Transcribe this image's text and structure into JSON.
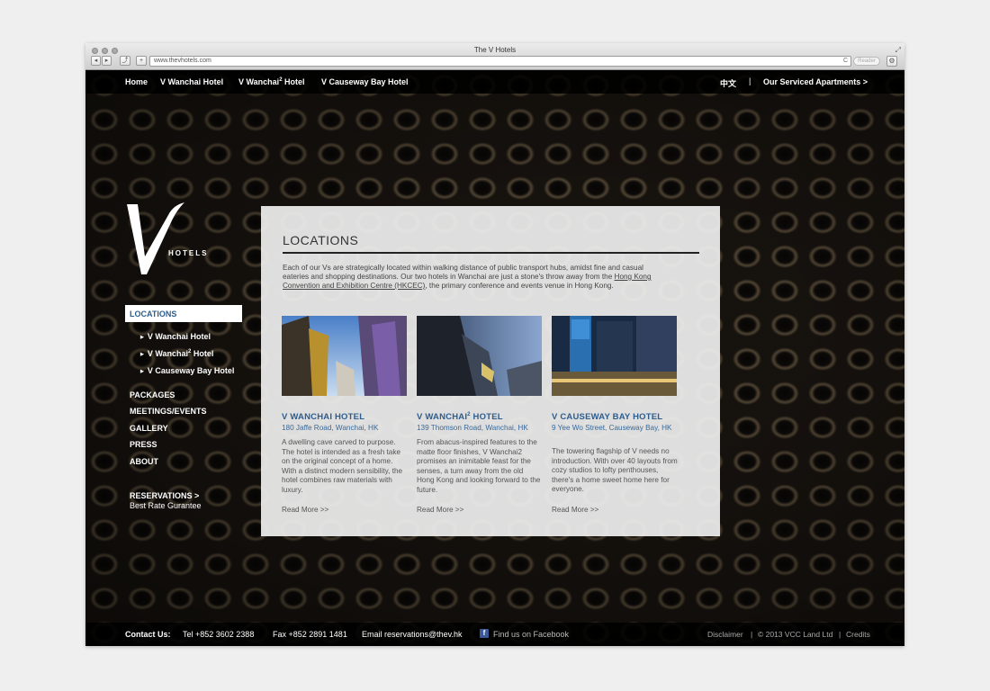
{
  "browser": {
    "window_title": "The V Hotels",
    "url": "www.thevhotels.com",
    "reader_label": "Reader",
    "back_glyph": "◂",
    "forward_glyph": "▸",
    "share_glyph": "⤴",
    "add_glyph": "+",
    "reload_glyph": "C",
    "gear_glyph": "⚙",
    "resize_glyph": "⤢"
  },
  "topnav": {
    "items": [
      {
        "label": "Home"
      },
      {
        "label": "V Wanchai Hotel"
      },
      {
        "label": "V Wanchai",
        "sup": "2",
        "suffix": " Hotel"
      },
      {
        "label": "V Causeway Bay Hotel"
      }
    ],
    "language": "中文",
    "separator": "|",
    "serviced": "Our Serviced Apartments >"
  },
  "logo": {
    "letter": "V",
    "word": "HOTELS"
  },
  "sidenav": {
    "active": "LOCATIONS",
    "sub_items": [
      {
        "label": "V Wanchai Hotel"
      },
      {
        "label": "V Wanchai",
        "sup": "2",
        "suffix": " Hotel"
      },
      {
        "label": "V Causeway Bay Hotel"
      }
    ],
    "bullet": "▶",
    "main_items": [
      "PACKAGES",
      "MEETINGS/EVENTS",
      "GALLERY",
      "PRESS",
      "ABOUT"
    ],
    "reservations": "RESERVATIONS >",
    "rate": "Best Rate Gurantee"
  },
  "panel": {
    "title": "LOCATIONS",
    "intro_1": "Each of our Vs are strategically located within walking distance of public transport hubs, amidst fine and casual eateries and shopping destinations. Our two hotels in Wanchai are just a stone's throw away from the ",
    "intro_link": "Hong Kong Convention and Exhibition Centre (HKCEC)",
    "intro_2": ", the primary conference and events venue in Hong Kong.",
    "cards": [
      {
        "name": "V WANCHAI HOTEL",
        "address": "180 Jaffe Road, Wanchai, HK",
        "description": "A dwelling cave carved to purpose. The hotel is intended as a fresh take on the original concept of a home. With a distinct modern sensibility, the hotel combines raw materials with luxury.",
        "more": "Read More >>"
      },
      {
        "name": "V WANCHAI",
        "name_sup": "2",
        "name_suffix": " HOTEL",
        "address": "139 Thomson Road, Wanchai, HK",
        "description": "From abacus-inspired features to the matte floor finishes, V Wanchai2 promises an inimitable feast for the senses, a turn away from the old Hong Kong and looking forward to the future.",
        "more": "Read More >>"
      },
      {
        "name": "V CAUSEWAY BAY HOTEL",
        "address": "9 Yee Wo Street, Causeway Bay, HK",
        "description": "The towering flagship of V needs no introduction. With over 40 layouts from cozy studios to lofty penthouses, there's a home sweet home here for everyone.",
        "more": "Read More >>"
      }
    ]
  },
  "footer": {
    "contact": "Contact Us:",
    "tel": "Tel +852 3602 2388",
    "fax": "Fax +852 2891 1481",
    "email": "Email reservations@thev.hk",
    "facebook_glyph": "f",
    "facebook": "Find us on Facebook",
    "disclaimer": "Disclaimer",
    "sep": "|",
    "copyright": "© 2013 VCC Land Ltd",
    "credits": "Credits"
  },
  "colors": {
    "accent": "#2c5d8f",
    "nav_bg": "#000000",
    "panel_bg": "#f0f0f0",
    "facebook": "#3b5998"
  }
}
